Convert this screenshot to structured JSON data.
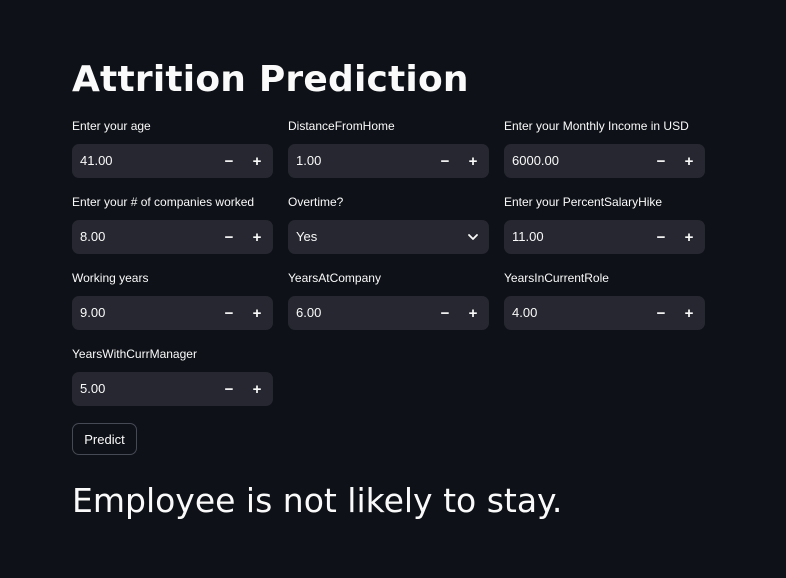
{
  "page": {
    "title": "Attrition Prediction"
  },
  "fields": {
    "age": {
      "label": "Enter your age",
      "value": "41.00"
    },
    "distance": {
      "label": "DistanceFromHome",
      "value": "1.00"
    },
    "income": {
      "label": "Enter your Monthly Income in USD",
      "value": "6000.00"
    },
    "companies": {
      "label": "Enter your # of companies worked",
      "value": "8.00"
    },
    "overtime": {
      "label": "Overtime?",
      "value": "Yes"
    },
    "salary_hike": {
      "label": "Enter your PercentSalaryHike",
      "value": "11.00"
    },
    "working_years": {
      "label": "Working years",
      "value": "9.00"
    },
    "years_at_company": {
      "label": "YearsAtCompany",
      "value": "6.00"
    },
    "years_in_role": {
      "label": "YearsInCurrentRole",
      "value": "4.00"
    },
    "years_with_manager": {
      "label": "YearsWithCurrManager",
      "value": "5.00"
    }
  },
  "stepper": {
    "minus_symbol": "−",
    "plus_symbol": "+"
  },
  "actions": {
    "predict_label": "Predict"
  },
  "result": {
    "text": "Employee is not likely to stay."
  },
  "icons": {
    "stepper_minus": "minus-icon",
    "stepper_plus": "plus-icon",
    "select_chevron": "chevron-down-icon"
  },
  "colors": {
    "background": "#0e1117",
    "input_background": "#262730",
    "text": "#fafafa",
    "button_border": "#464a55"
  }
}
